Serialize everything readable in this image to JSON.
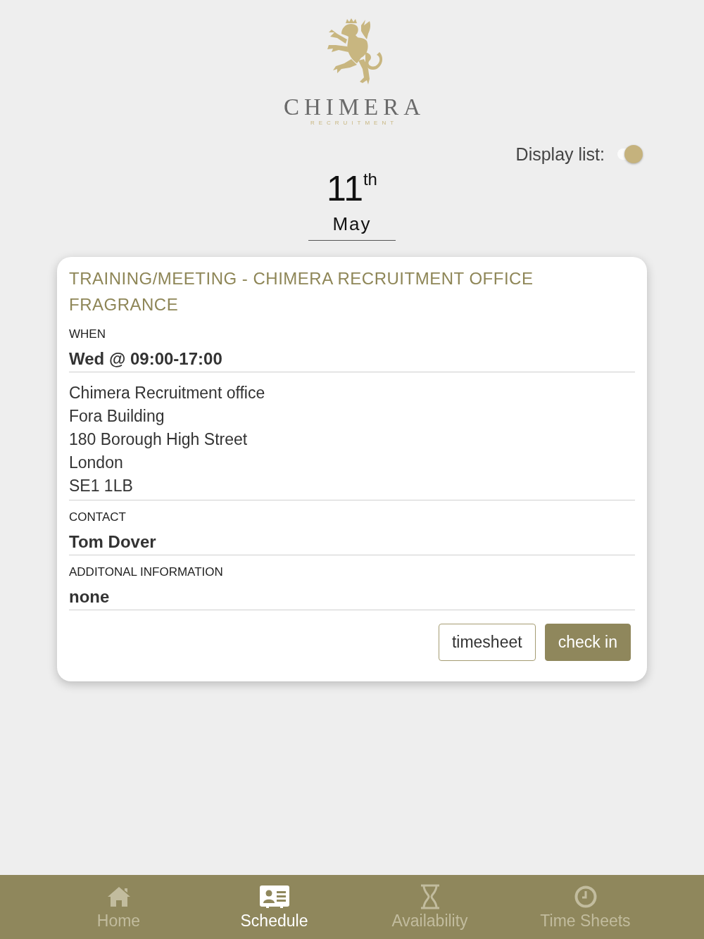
{
  "logo": {
    "name": "CHIMERA",
    "tagline": "RECRUITMENT"
  },
  "display_list": {
    "label": "Display list:",
    "on": true
  },
  "date": {
    "day": "11",
    "suffix": "th",
    "month": "May"
  },
  "event": {
    "title": "TRAINING/MEETING - CHIMERA RECRUITMENT OFFICE FRAGRANCE",
    "sections": [
      {
        "kind": "field",
        "label": "WHEN",
        "value": "Wed @ 09:00-17:00"
      },
      {
        "kind": "address",
        "lines": [
          "Chimera Recruitment office",
          "Fora Building",
          "180 Borough High Street",
          "London",
          "SE1 1LB"
        ]
      },
      {
        "kind": "field",
        "label": "CONTACT",
        "value": "Tom Dover"
      },
      {
        "kind": "field",
        "label": "ADDITONAL INFORMATION",
        "value": "none"
      }
    ],
    "buttons": [
      {
        "kind": "outline",
        "label": "timesheet"
      },
      {
        "kind": "filled",
        "label": "check in"
      }
    ]
  },
  "nav": [
    {
      "kind": "home",
      "label": "Home",
      "selected": false
    },
    {
      "kind": "schedule",
      "label": "Schedule",
      "selected": true
    },
    {
      "kind": "availability",
      "label": "Availability",
      "selected": false
    },
    {
      "kind": "timesheets",
      "label": "Time Sheets",
      "selected": false
    }
  ]
}
